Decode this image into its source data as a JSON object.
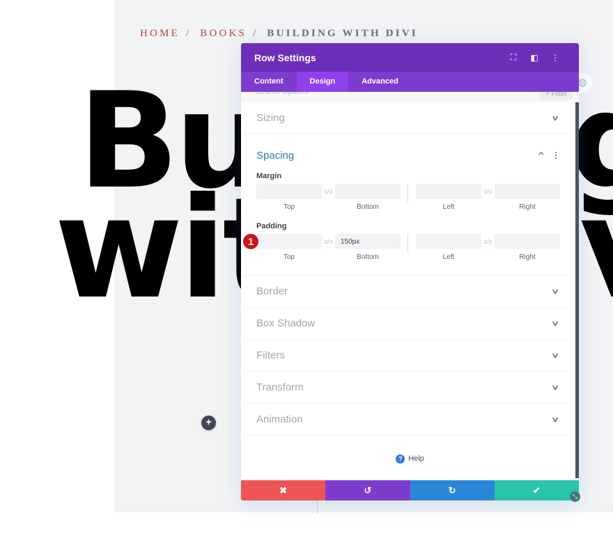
{
  "page": {
    "breadcrumb": [
      {
        "label": "HOME",
        "link": true
      },
      {
        "label": "BOOKS",
        "link": true
      },
      {
        "label": "BUILDING WITH DIVI",
        "link": false
      }
    ],
    "breadcrumb_separator": "/",
    "hero_lines": [
      "Building",
      "with Divi"
    ],
    "add_button_glyph": "+",
    "globe_icon_glyph": "◍"
  },
  "modal": {
    "title": "Row Settings",
    "header_icons": [
      {
        "name": "focus-icon",
        "glyph": "⛶"
      },
      {
        "name": "sidebar-layout-icon",
        "glyph": "◧"
      },
      {
        "name": "more-options-icon",
        "glyph": "⋮"
      }
    ],
    "tabs": [
      {
        "label": "Content",
        "active": false
      },
      {
        "label": "Design",
        "active": true
      },
      {
        "label": "Advanced",
        "active": false
      }
    ],
    "search": {
      "placeholder": "Search Options",
      "filter_label": "+ Filter"
    },
    "sections": [
      {
        "title": "Sizing",
        "open": false
      }
    ],
    "spacing": {
      "title": "Spacing",
      "open": true,
      "collapse_glyph": "^",
      "kebab_glyph": "⋮",
      "link_glyph": "c/ɔ",
      "margin": {
        "label": "Margin",
        "fields": [
          {
            "side": "Top",
            "value": ""
          },
          {
            "side": "Bottom",
            "value": ""
          },
          {
            "side": "Left",
            "value": ""
          },
          {
            "side": "Right",
            "value": ""
          }
        ]
      },
      "padding": {
        "label": "Padding",
        "badge": "1",
        "fields": [
          {
            "side": "Top",
            "value": ""
          },
          {
            "side": "Bottom",
            "value": "150px"
          },
          {
            "side": "Left",
            "value": ""
          },
          {
            "side": "Right",
            "value": ""
          }
        ]
      }
    },
    "collapsed_sections": [
      "Border",
      "Box Shadow",
      "Filters",
      "Transform",
      "Animation"
    ],
    "chevron_glyph": "v",
    "help": {
      "icon": "?",
      "label": "Help"
    },
    "footer": {
      "cancel_glyph": "✖",
      "undo_glyph": "↺",
      "redo_glyph": "↻",
      "save_glyph": "✔"
    },
    "resize_glyph": "⤡"
  },
  "colors": {
    "header_purple": "#6c2eb9",
    "tab_purple": "#7d3bcf",
    "active_tab": "#8f42ec",
    "spacing_title": "#2f7cb3",
    "cancel": "#ef5555",
    "undo": "#7e3ccf",
    "redo": "#2a87d8",
    "save": "#29c4a9",
    "badge": "#d1111a",
    "breadcrumb_link": "#b3463f"
  }
}
